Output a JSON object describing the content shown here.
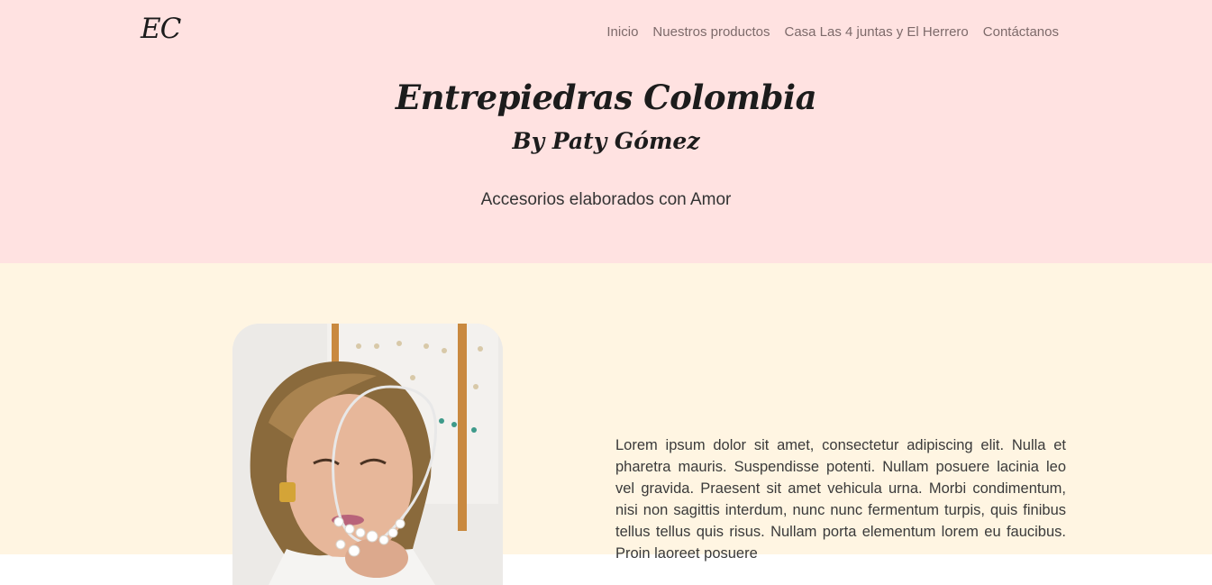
{
  "header": {
    "logo": "EC",
    "nav": [
      "Inicio",
      "Nuestros productos",
      "Casa Las 4 juntas y El Herrero",
      "Contáctanos"
    ]
  },
  "hero": {
    "title": "Entrepiedras Colombia",
    "subtitle": "By Paty Gómez",
    "tagline": "Accesorios elaborados con Amor"
  },
  "about": {
    "photo_alt": "Paty Gómez sosteniendo un collar",
    "text": "Lorem ipsum dolor sit amet, consectetur adipiscing elit. Nulla et pharetra mauris. Suspendisse potenti. Nullam posuere lacinia leo vel gravida. Praesent sit amet vehicula urna. Morbi condimentum, nisi non sagittis interdum, nunc nunc fermentum turpis, quis finibus tellus tellus quis risus. Nullam porta elementum lorem eu faucibus. Proin laoreet posuere"
  },
  "colors": {
    "header_bg": "#ffe2e1",
    "content_bg": "#fff5e2",
    "nav_text": "#7d6a6a"
  }
}
